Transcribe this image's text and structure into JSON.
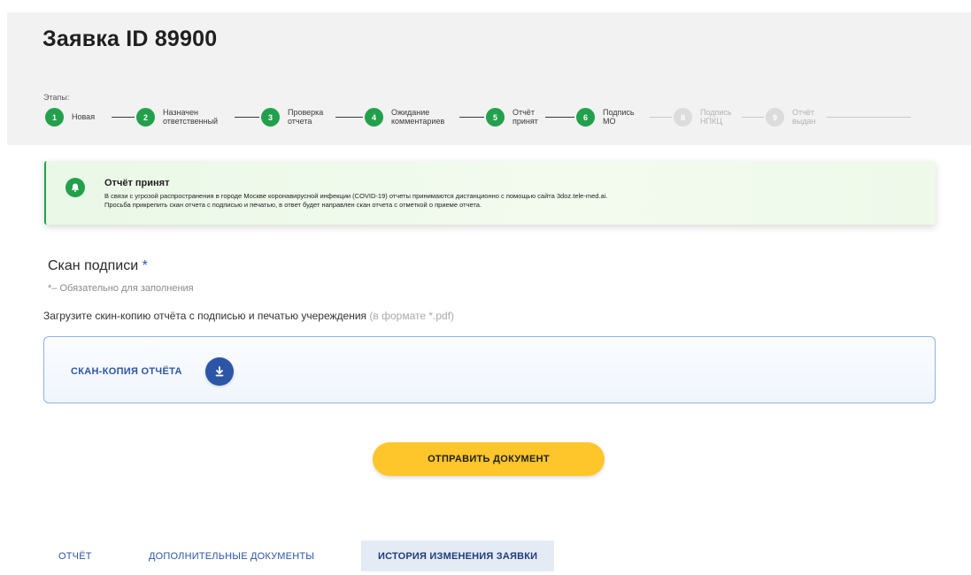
{
  "title": "Заявка ID 89900",
  "stages_label": "Этапы:",
  "steps": [
    {
      "num": "1",
      "label": "Новая",
      "active": true
    },
    {
      "num": "2",
      "label": "Назначен\nответственный",
      "active": true
    },
    {
      "num": "3",
      "label": "Проверка\nотчета",
      "active": true
    },
    {
      "num": "4",
      "label": "Ожидание\nкомментариев",
      "active": true
    },
    {
      "num": "5",
      "label": "Отчёт\nпринят",
      "active": true
    },
    {
      "num": "6",
      "label": "Подпись\nМО",
      "active": true
    },
    {
      "num": "8",
      "label": "Подпись\nНПКЦ",
      "active": false
    },
    {
      "num": "9",
      "label": "Отчёт\nвыдан",
      "active": false
    }
  ],
  "alert": {
    "title": "Отчёт принят",
    "line1": "В связи с угрозой распространения в городе Москве коронавирусной инфекции (COVID-19) отчеты принимаются дистанционно с помощью сайта 3doz.tele-med.ai.",
    "line2": "Просьба прикрепить скан отчета с подписью и печатью, в ответ будет направлен скан отчета с отметкой о приеме отчета.",
    "icon": "bell-icon",
    "color": "#22a04b"
  },
  "section": {
    "title": "Скан подписи",
    "required_mark": "*",
    "required_note": "*– Обязательно для заполнения",
    "instruction": "Загрузите скин-копию отчёта с подписью и печатью учереждения",
    "instruction_hint": "(в формате *.pdf)"
  },
  "upload": {
    "label": "СКАН-КОПИЯ ОТЧЁТА",
    "icon": "download-icon"
  },
  "submit_label": "ОТПРАВИТЬ ДОКУМЕНТ",
  "tabs": [
    {
      "label": "ОТЧЁТ",
      "active": false
    },
    {
      "label": "ДОПОЛНИТЕЛЬНЫЕ ДОКУМЕНТЫ",
      "active": false
    },
    {
      "label": "ИСТОРИЯ ИЗМЕНЕНИЯ ЗАЯВКИ",
      "active": true
    }
  ],
  "colors": {
    "accent_green": "#22a04b",
    "accent_blue": "#2c55a6",
    "button_yellow": "#fec62a"
  }
}
